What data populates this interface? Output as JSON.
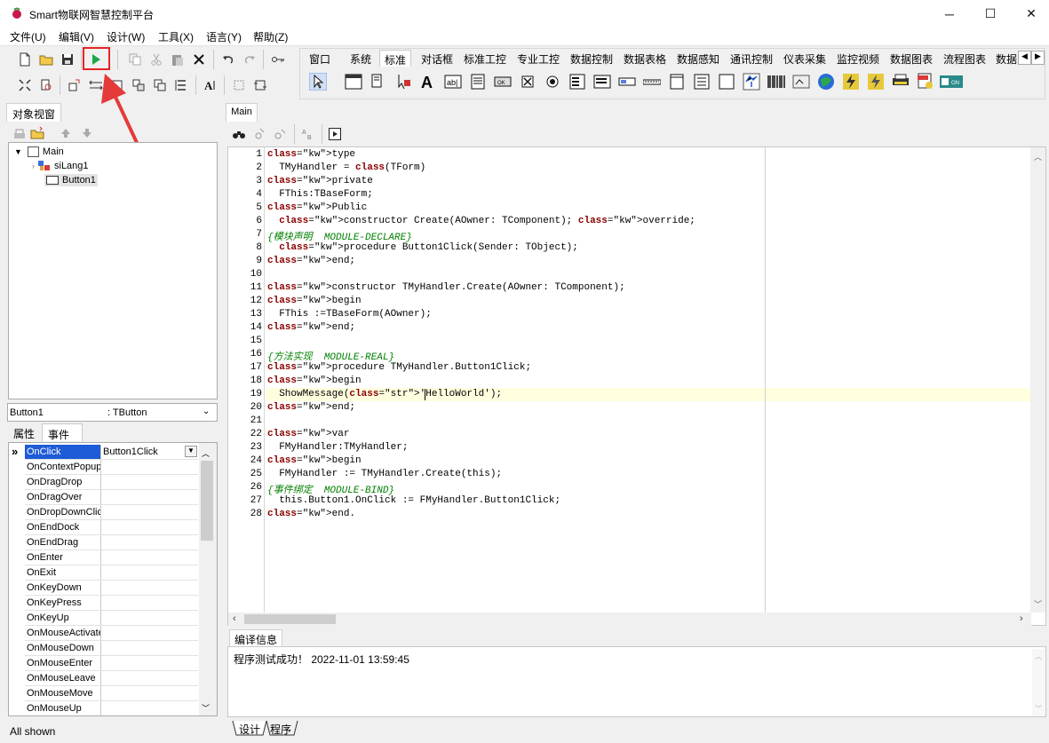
{
  "window": {
    "title": "Smart物联网智慧控制平台",
    "controls": [
      "─",
      "☐",
      "✕"
    ]
  },
  "menu": [
    "文件(U)",
    "编辑(V)",
    "设计(W)",
    "工具(X)",
    "语言(Y)",
    "帮助(Z)"
  ],
  "palette_tabs": [
    "窗口",
    "系统",
    "标准",
    "对话框",
    "标准工控",
    "专业工控",
    "数据控制",
    "数据表格",
    "数据感知",
    "通讯控制",
    "仪表采集",
    "监控视频",
    "数据图表",
    "流程图表",
    "数据"
  ],
  "palette_active": "标准",
  "palette_icons": [
    "pointer-icon",
    "form-icon",
    "panel-icon",
    "cursor-icon",
    "label-icon",
    "edit-icon",
    "memo-icon",
    "button-icon",
    "checkbox-icon",
    "radio-icon",
    "listbox-icon",
    "combobox-icon",
    "scrollbar-icon",
    "groupbox-icon",
    "radiogroup-icon",
    "panel2-icon",
    "image-icon",
    "barcode-icon",
    "chart-icon",
    "globe-icon",
    "lightning-icon",
    "lightning2-icon",
    "printer-icon",
    "pdf-icon",
    "switch-icon"
  ],
  "object_view": {
    "tab_label": "对象视窗",
    "tree": {
      "root": "Main",
      "children": [
        "siLang1",
        "Button1"
      ]
    }
  },
  "inspector": {
    "component": "Button1",
    "type": ": TButton",
    "tabs": [
      "属性",
      "事件"
    ],
    "active_tab": "事件",
    "events": [
      {
        "name": "OnClick",
        "value": "Button1Click"
      },
      {
        "name": "OnContextPopup",
        "value": ""
      },
      {
        "name": "OnDragDrop",
        "value": ""
      },
      {
        "name": "OnDragOver",
        "value": ""
      },
      {
        "name": "OnDropDownClick",
        "value": ""
      },
      {
        "name": "OnEndDock",
        "value": ""
      },
      {
        "name": "OnEndDrag",
        "value": ""
      },
      {
        "name": "OnEnter",
        "value": ""
      },
      {
        "name": "OnExit",
        "value": ""
      },
      {
        "name": "OnKeyDown",
        "value": ""
      },
      {
        "name": "OnKeyPress",
        "value": ""
      },
      {
        "name": "OnKeyUp",
        "value": ""
      },
      {
        "name": "OnMouseActivate",
        "value": ""
      },
      {
        "name": "OnMouseDown",
        "value": ""
      },
      {
        "name": "OnMouseEnter",
        "value": ""
      },
      {
        "name": "OnMouseLeave",
        "value": ""
      },
      {
        "name": "OnMouseMove",
        "value": ""
      },
      {
        "name": "OnMouseUp",
        "value": ""
      }
    ],
    "status": "All shown"
  },
  "editor": {
    "tab_label": "Main",
    "current_line": 19,
    "lines": [
      "type",
      "  TMyHandler = class(TForm)",
      "private",
      "  FThis:TBaseForm;",
      "Public",
      "  constructor Create(AOwner: TComponent); override;",
      "{模块声明  MODULE-DECLARE}",
      "  procedure Button1Click(Sender: TObject);",
      "end;",
      "",
      "constructor TMyHandler.Create(AOwner: TComponent);",
      "begin",
      "  FThis :=TBaseForm(AOwner);",
      "end;",
      "",
      "{方法实现  MODULE-REAL}",
      "procedure TMyHandler.Button1Click;",
      "begin",
      "  ShowMessage('HelloWorld');",
      "end;",
      "",
      "var",
      "  FMyHandler:TMyHandler;",
      "begin",
      "  FMyHandler := TMyHandler.Create(this);",
      "{事件绑定  MODULE-BIND}",
      "  this.Button1.OnClick := FMyHandler.Button1Click;",
      "end."
    ]
  },
  "compile_info": {
    "tab_label": "编译信息",
    "message": "程序测试成功！ 2022-11-01 13:59:45"
  },
  "bottom_tabs": [
    "设计",
    "程序"
  ],
  "colors": {
    "highlight_box": "#e52424",
    "current_line_bg": "#ffffe0",
    "selected_event_bg": "#1e5bd6",
    "keyword": "#8a0000",
    "comment": "#008000"
  }
}
